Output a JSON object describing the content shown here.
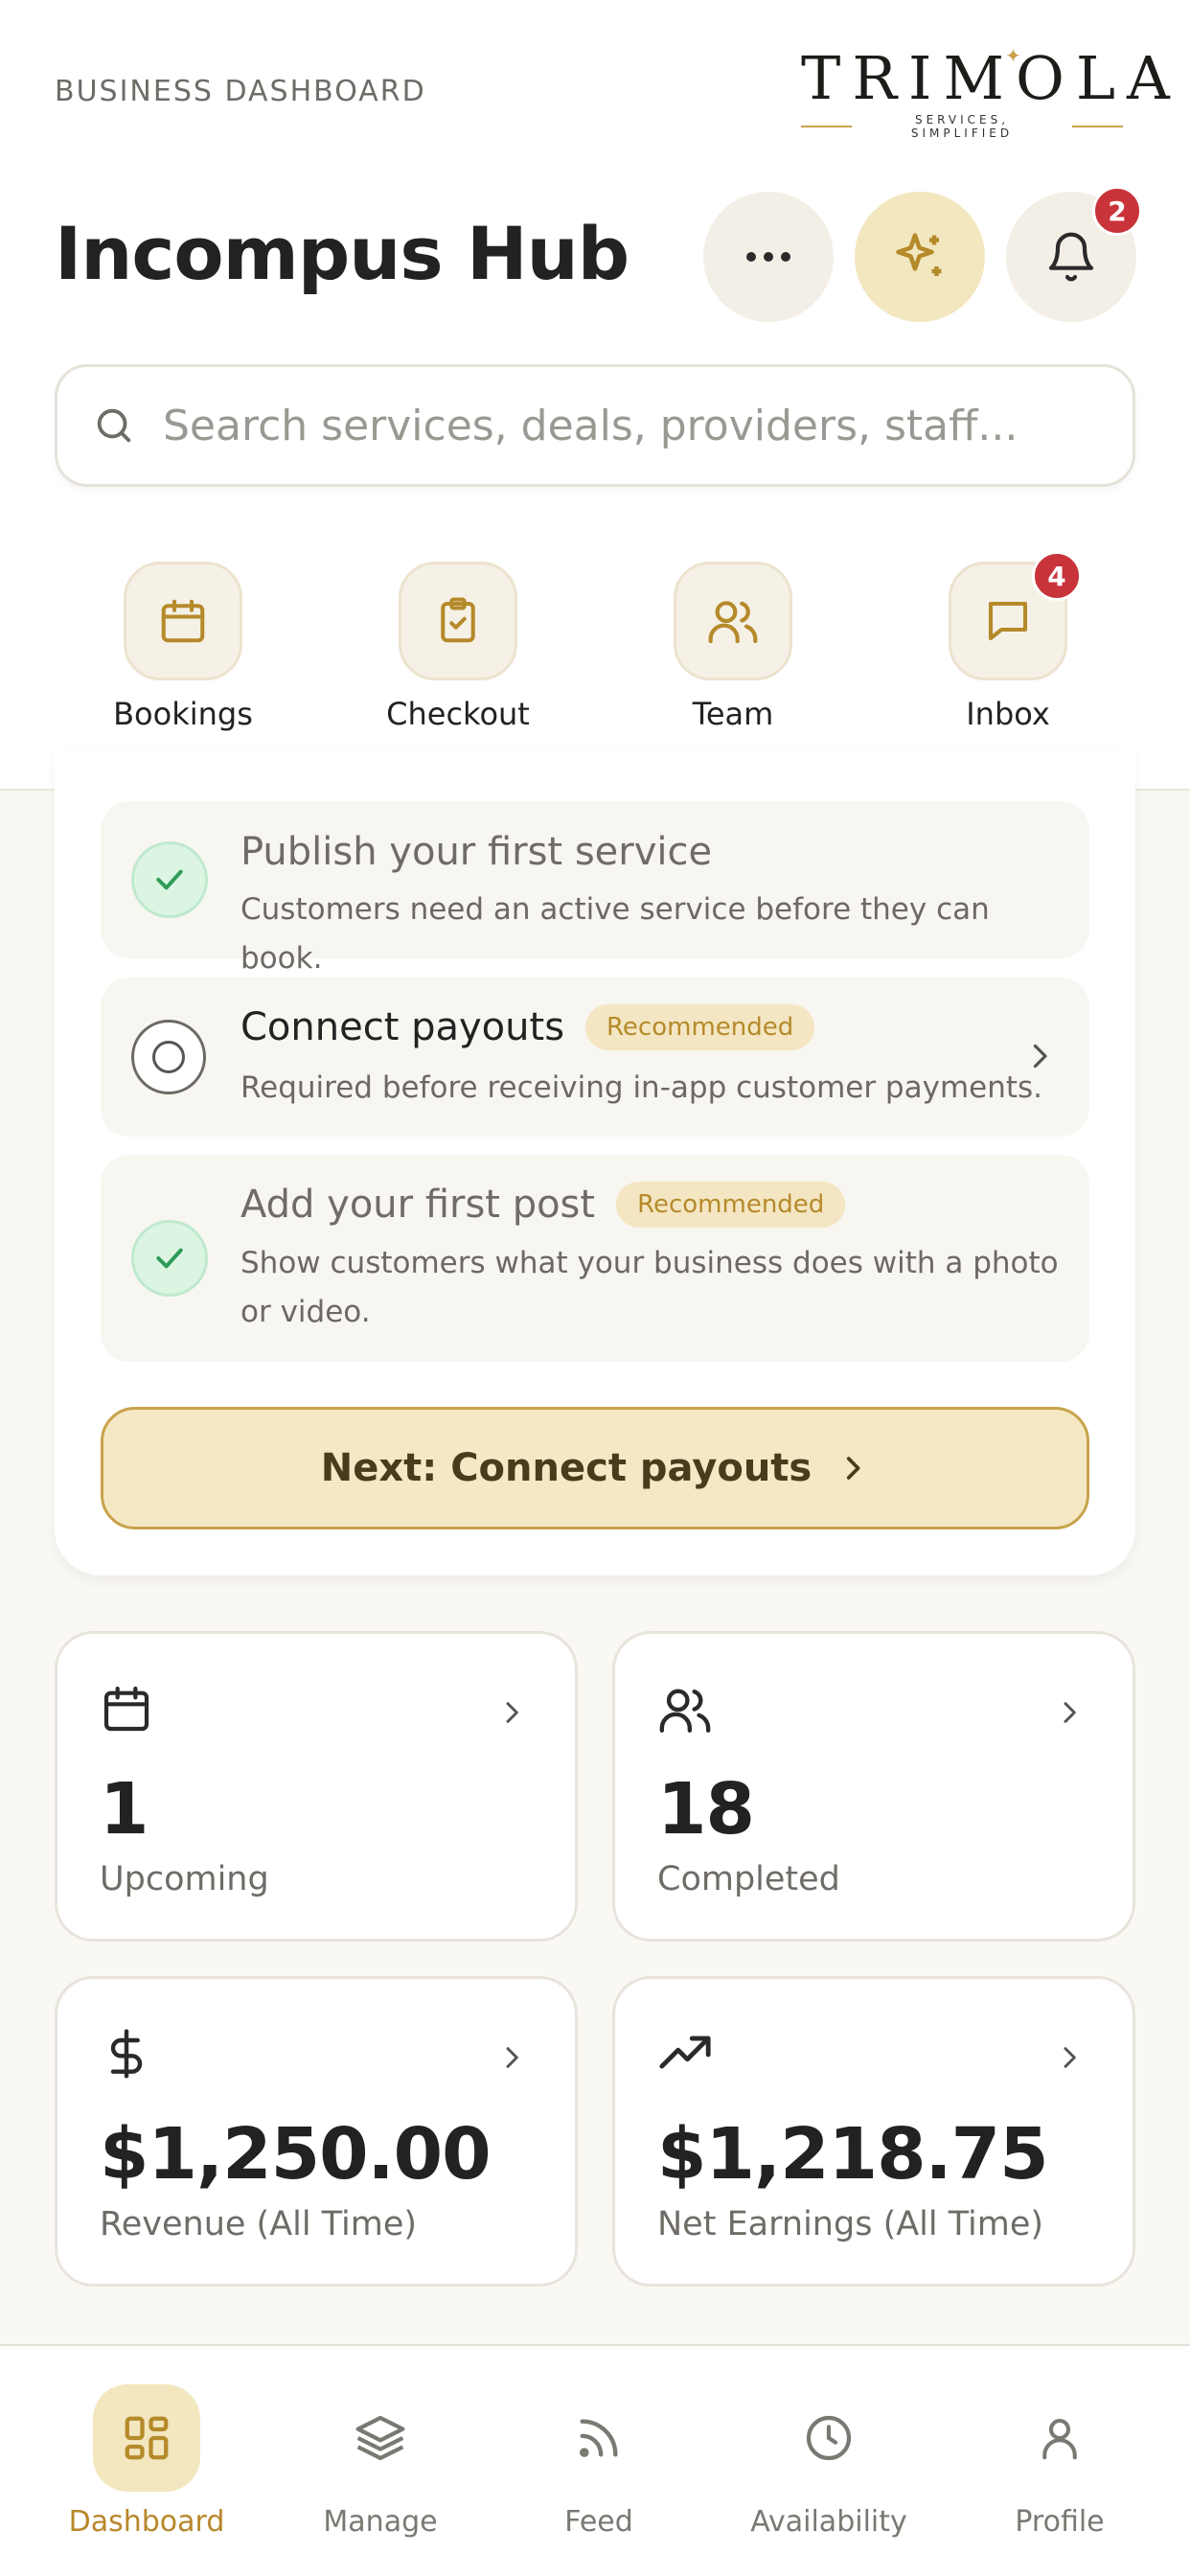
{
  "header": {
    "eyebrow": "BUSINESS DASHBOARD",
    "logo_word": "TRIMOLA",
    "logo_tagline": "SERVICES, SIMPLIFIED",
    "title": "Incompus Hub",
    "notification_count": "2"
  },
  "search": {
    "placeholder": "Search services, deals, providers, staff..."
  },
  "quick_actions": [
    {
      "label": "Bookings",
      "icon": "calendar-icon"
    },
    {
      "label": "Checkout",
      "icon": "clipboard-check-icon"
    },
    {
      "label": "Team",
      "icon": "users-icon"
    },
    {
      "label": "Inbox",
      "icon": "message-icon",
      "badge": "4"
    }
  ],
  "checklist": {
    "items": [
      {
        "title": "Publish your first service",
        "description": "Customers need an active service before they can book.",
        "done": true
      },
      {
        "title": "Connect payouts",
        "badge": "Recommended",
        "description": "Required before receiving in-app customer payments.",
        "done": false
      },
      {
        "title": "Add your first post",
        "badge": "Recommended",
        "description": "Show customers what your business does with a photo or video.",
        "done": true
      }
    ],
    "next_button": "Next: Connect payouts"
  },
  "stats": [
    {
      "value": "1",
      "label": "Upcoming",
      "icon": "calendar-icon"
    },
    {
      "value": "18",
      "label": "Completed",
      "icon": "users-icon"
    },
    {
      "value": "$1,250.00",
      "label": "Revenue (All Time)",
      "icon": "dollar-icon"
    },
    {
      "value": "$1,218.75",
      "label": "Net Earnings (All Time)",
      "icon": "trending-up-icon"
    }
  ],
  "tabs": [
    {
      "label": "Dashboard",
      "icon": "grid-icon",
      "active": true
    },
    {
      "label": "Manage",
      "icon": "layers-icon"
    },
    {
      "label": "Feed",
      "icon": "rss-icon"
    },
    {
      "label": "Availability",
      "icon": "clock-icon"
    },
    {
      "label": "Profile",
      "icon": "user-icon"
    }
  ],
  "colors": {
    "accent": "#c9a24a",
    "accent_soft": "#f3e7bf",
    "badge_red": "#c9333a",
    "success_green": "#2e9b57"
  }
}
